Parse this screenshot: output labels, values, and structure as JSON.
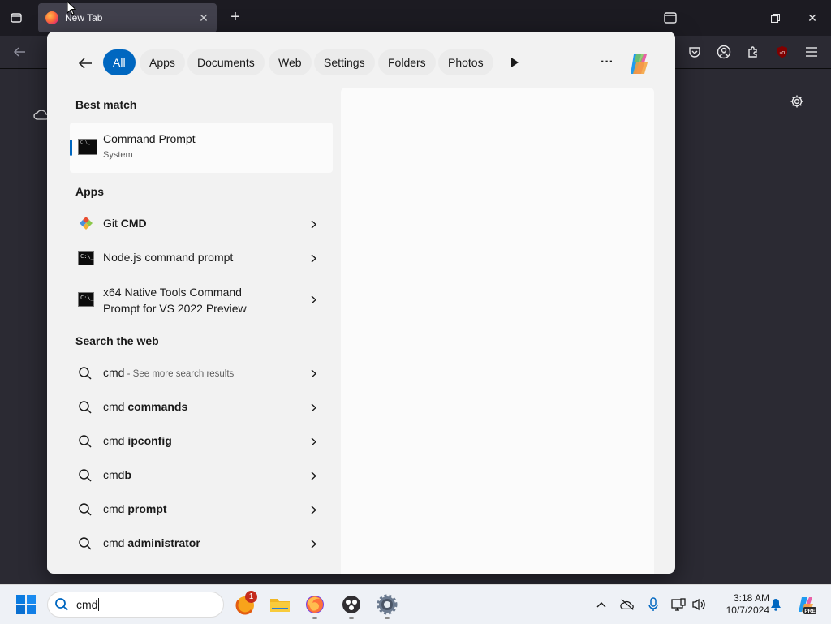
{
  "browser": {
    "tab_title": "New Tab"
  },
  "filters": {
    "items": [
      {
        "label": "All",
        "active": true
      },
      {
        "label": "Apps"
      },
      {
        "label": "Documents"
      },
      {
        "label": "Web"
      },
      {
        "label": "Settings"
      },
      {
        "label": "Folders"
      },
      {
        "label": "Photos"
      }
    ],
    "more_label": "···"
  },
  "best_match": {
    "heading": "Best match",
    "name": "Command Prompt",
    "subtitle": "System"
  },
  "apps": {
    "heading": "Apps",
    "items": [
      {
        "prefix": "Git ",
        "bold": "CMD"
      },
      {
        "prefix": "Node.js command prompt",
        "bold": ""
      },
      {
        "line1": "x64 Native Tools Command",
        "line2": "Prompt for VS 2022 Preview"
      }
    ]
  },
  "web": {
    "heading": "Search the web",
    "items": [
      {
        "prefix": "cmd",
        "bold": "",
        "hint": " - See more search results"
      },
      {
        "prefix": "cmd ",
        "bold": "commands"
      },
      {
        "prefix": "cmd ",
        "bold": "ipconfig"
      },
      {
        "prefix": "cmd",
        "bold": "b"
      },
      {
        "prefix": "cmd ",
        "bold": "prompt"
      },
      {
        "prefix": "cmd ",
        "bold": "administrator"
      }
    ]
  },
  "taskbar": {
    "search_value": "cmd",
    "badge_count": "1",
    "time": "3:18 AM",
    "date": "10/7/2024",
    "copilot_badge": "PRE"
  },
  "colors": {
    "accent": "#0067c0",
    "panel_bg": "#f2f2f2",
    "browser_bg": "#1c1b22"
  }
}
